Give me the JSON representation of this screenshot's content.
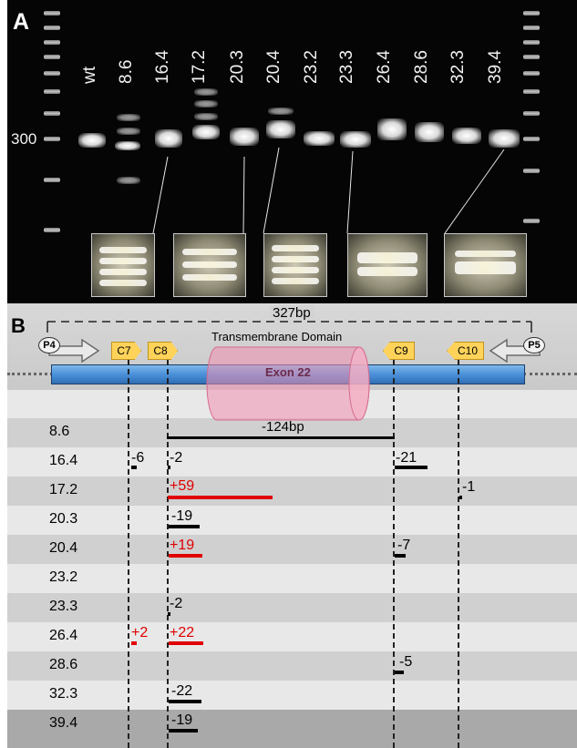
{
  "panel_a": {
    "letter": "A",
    "marker_label": "300",
    "lane_labels": [
      "wt",
      "8.6",
      "16.4",
      "17.2",
      "20.3",
      "20.4",
      "23.2",
      "23.3",
      "26.4",
      "28.6",
      "32.3",
      "39.4"
    ]
  },
  "panel_b": {
    "letter": "B",
    "amplicon_label": "327bp",
    "tm_label": "Transmembrane Domain",
    "exon_label": "Exon 22",
    "primer_left": "P4",
    "primer_right": "P5",
    "cut_sites": [
      "C7",
      "C8",
      "C9",
      "C10"
    ],
    "deletion_label": "-124bp",
    "rows": [
      {
        "name": "8.6"
      },
      {
        "name": "16.4",
        "m1": "-6",
        "m2": "-2",
        "m3": "-21"
      },
      {
        "name": "17.2",
        "m2": "+59",
        "m4": "-1"
      },
      {
        "name": "20.3",
        "m2": "-19"
      },
      {
        "name": "20.4",
        "m2": "+19",
        "m3": "-7"
      },
      {
        "name": "23.2"
      },
      {
        "name": "23.3",
        "m2": "-2"
      },
      {
        "name": "26.4",
        "m1": "+2",
        "m2": "+22"
      },
      {
        "name": "28.6",
        "m3": "-5"
      },
      {
        "name": "32.3",
        "m2": "-22"
      },
      {
        "name": "39.4",
        "m2": "-19"
      }
    ]
  },
  "colors": {
    "insertion": "#e00000",
    "deletion": "#000000",
    "exon_bar": "#4a90d9",
    "tm_domain": "#f08fb0",
    "cut_tag": "#ffd35a"
  }
}
